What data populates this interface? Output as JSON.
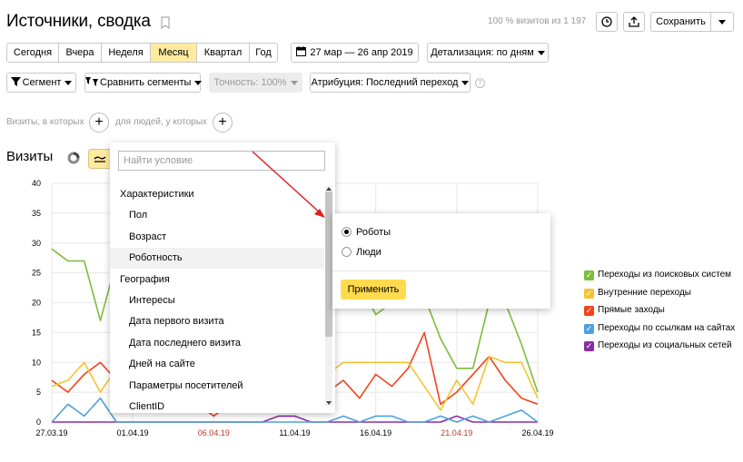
{
  "header": {
    "title": "Источники, сводка",
    "visits_info": "100 % визитов из 1 197",
    "save_label": "Сохранить"
  },
  "period_tabs": [
    "Сегодня",
    "Вчера",
    "Неделя",
    "Месяц",
    "Квартал",
    "Год"
  ],
  "active_period": "Месяц",
  "date_range": "27 мар — 26 апр 2019",
  "detail_label": "Детализация: по дням",
  "toolbar2": {
    "segment_label": "Сегмент",
    "compare_label": "Сравнить сегменты",
    "accuracy_label": "Точность: 100%",
    "attribution_label": "Атрибуция: Последний переход"
  },
  "filter": {
    "visits_label": "Визиты, в которых",
    "people_label": "для людей, у которых"
  },
  "chart_title": "Визиты",
  "dropdown": {
    "search_placeholder": "Найти условие",
    "items": [
      {
        "label": "Характеристики",
        "type": "group"
      },
      {
        "label": "Пол",
        "type": "item"
      },
      {
        "label": "Возраст",
        "type": "item"
      },
      {
        "label": "Роботность",
        "type": "item",
        "active": true
      },
      {
        "label": "География",
        "type": "group"
      },
      {
        "label": "Интересы",
        "type": "item"
      },
      {
        "label": "Дата первого визита",
        "type": "item"
      },
      {
        "label": "Дата последнего визита",
        "type": "item"
      },
      {
        "label": "Дней на сайте",
        "type": "item"
      },
      {
        "label": "Параметры посетителей",
        "type": "item"
      },
      {
        "label": "ClientID",
        "type": "item"
      }
    ]
  },
  "popup": {
    "option_robots": "Роботы",
    "option_people": "Люди",
    "apply_label": "Применить"
  },
  "legend": [
    {
      "label": "Переходы из поисковых систем",
      "color": "#7cbd3c"
    },
    {
      "label": "Внутренние переходы",
      "color": "#f5c330"
    },
    {
      "label": "Прямые заходы",
      "color": "#f2431c"
    },
    {
      "label": "Переходы по ссылкам на сайтах",
      "color": "#4ea0e0"
    },
    {
      "label": "Переходы из социальных сетей",
      "color": "#8a2ea4"
    }
  ],
  "chart_data": {
    "type": "line",
    "x": [
      "27.03.19",
      "28.03.19",
      "29.03.19",
      "30.03.19",
      "31.03.19",
      "01.04.19",
      "02.04.19",
      "03.04.19",
      "04.04.19",
      "05.04.19",
      "06.04.19",
      "07.04.19",
      "08.04.19",
      "09.04.19",
      "10.04.19",
      "11.04.19",
      "12.04.19",
      "13.04.19",
      "14.04.19",
      "15.04.19",
      "16.04.19",
      "17.04.19",
      "18.04.19",
      "19.04.19",
      "20.04.19",
      "21.04.19",
      "22.04.19",
      "23.04.19",
      "24.04.19",
      "25.04.19",
      "26.04.19"
    ],
    "x_tick_labels": [
      "27.03.19",
      "01.04.19",
      "06.04.19",
      "11.04.19",
      "16.04.19",
      "21.04.19",
      "26.04.19"
    ],
    "ylim": [
      0,
      40
    ],
    "y_ticks": [
      0,
      5,
      10,
      15,
      20,
      25,
      30,
      35,
      40
    ],
    "series": [
      {
        "name": "Переходы из поисковых систем",
        "color": "#7cbd3c",
        "values": [
          29,
          27,
          27,
          17,
          27,
          27,
          26,
          22,
          21,
          20,
          21,
          22,
          22,
          22,
          22,
          22,
          22,
          23,
          23,
          23,
          18,
          20,
          21,
          21,
          14,
          9,
          9,
          20,
          20,
          13,
          5
        ]
      },
      {
        "name": "Внутренние переходы",
        "color": "#f5c330",
        "values": [
          6,
          7,
          10,
          5,
          9,
          8,
          7,
          6,
          5,
          5,
          5,
          5,
          5,
          5,
          5,
          5,
          4,
          8,
          10,
          10,
          10,
          10,
          10,
          6,
          2,
          7,
          3,
          11,
          10,
          10,
          4
        ]
      },
      {
        "name": "Прямые заходы",
        "color": "#f2431c",
        "values": [
          7,
          5,
          8,
          10,
          7,
          8,
          6,
          5,
          3,
          3,
          1,
          3,
          3,
          3,
          3,
          3,
          3,
          5,
          7,
          4,
          8,
          6,
          9,
          15,
          3,
          5,
          8,
          11,
          7,
          4,
          3
        ]
      },
      {
        "name": "Переходы по ссылкам на сайтах",
        "color": "#4ea0e0",
        "values": [
          0,
          3,
          1,
          4,
          0,
          0,
          0,
          0,
          0,
          0,
          0,
          0,
          0,
          0,
          0,
          0,
          0,
          0,
          1,
          0,
          1,
          1,
          0,
          0,
          1,
          0,
          1,
          0,
          1,
          2,
          0
        ]
      },
      {
        "name": "Переходы из социальных сетей",
        "color": "#8a2ea4",
        "values": [
          0,
          0,
          0,
          0,
          0,
          0,
          0,
          0,
          0,
          0,
          0,
          0,
          0,
          0,
          1,
          1,
          0,
          0,
          0,
          0,
          0,
          0,
          0,
          0,
          0,
          1,
          0,
          0,
          0,
          0,
          0
        ]
      }
    ]
  }
}
